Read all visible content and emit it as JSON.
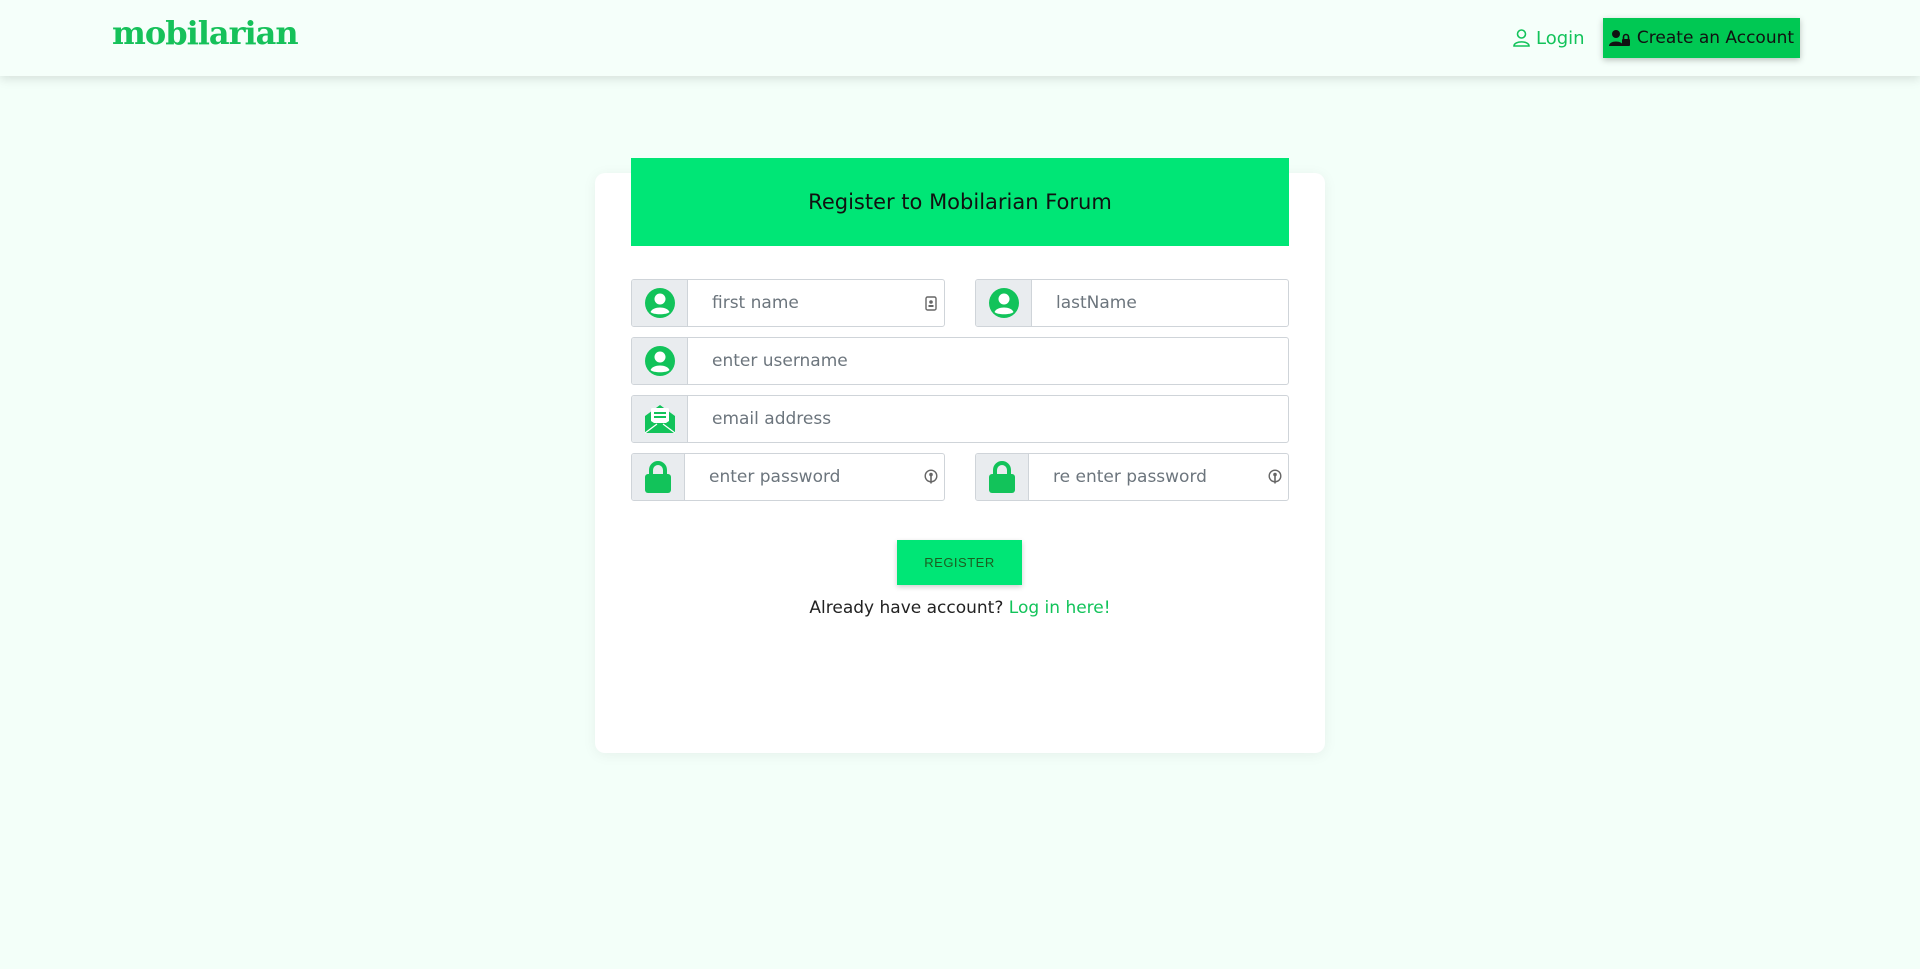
{
  "header": {
    "brand": "mobilarian",
    "login_label": "Login",
    "create_account_label": "Create an Account"
  },
  "form": {
    "title": "Register to Mobilarian Forum",
    "first_name_placeholder": "first name",
    "last_name_placeholder": "lastName",
    "username_placeholder": "enter username",
    "email_placeholder": "email address",
    "password_placeholder": "enter password",
    "confirm_password_placeholder": "re enter password",
    "register_label": "REGISTER",
    "already_text": "Already have account?",
    "login_link": "Log in here!"
  },
  "colors": {
    "accent": "#00e676",
    "brand": "#16c15a",
    "create_button": "#00c853"
  }
}
